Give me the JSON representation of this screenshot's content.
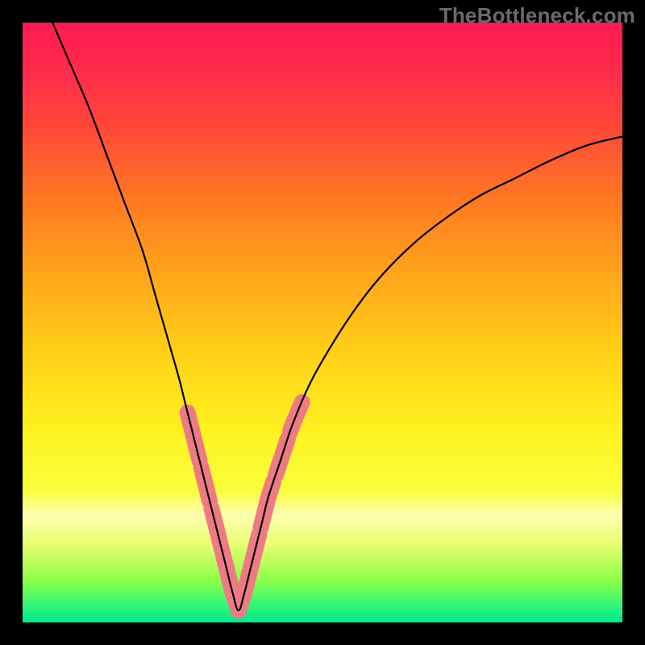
{
  "watermark": "TheBottleneck.com",
  "gradient_stops": [
    {
      "offset": 0.0,
      "color": "#ff1a52"
    },
    {
      "offset": 0.08,
      "color": "#ff2b4b"
    },
    {
      "offset": 0.18,
      "color": "#ff4a37"
    },
    {
      "offset": 0.3,
      "color": "#ff7a22"
    },
    {
      "offset": 0.42,
      "color": "#ffa51a"
    },
    {
      "offset": 0.55,
      "color": "#ffd017"
    },
    {
      "offset": 0.68,
      "color": "#fff220"
    },
    {
      "offset": 0.78,
      "color": "#f8ff3c"
    },
    {
      "offset": 0.82,
      "color": "#ffffb0"
    },
    {
      "offset": 0.87,
      "color": "#e8ff70"
    },
    {
      "offset": 0.93,
      "color": "#8cff4a"
    },
    {
      "offset": 0.975,
      "color": "#28f57a"
    },
    {
      "offset": 1.0,
      "color": "#00e88e"
    }
  ],
  "chart_data": {
    "type": "line",
    "title": "",
    "xlabel": "",
    "ylabel": "",
    "xlim": [
      0,
      100
    ],
    "ylim": [
      0,
      100
    ],
    "series": [
      {
        "name": "curve-left",
        "x": [
          5,
          8,
          11,
          14,
          17,
          20,
          22,
          24,
          26,
          27,
          28,
          29,
          30,
          31,
          32,
          33,
          34,
          35,
          36
        ],
        "y": [
          100,
          93,
          86,
          78,
          70,
          62,
          55,
          48,
          41,
          37,
          33,
          29,
          25,
          21,
          17,
          13,
          9,
          5,
          2
        ]
      },
      {
        "name": "curve-right",
        "x": [
          36,
          37,
          38,
          39,
          40,
          41,
          43,
          45,
          48,
          52,
          56,
          60,
          65,
          70,
          76,
          82,
          88,
          94,
          100
        ],
        "y": [
          2,
          5,
          9,
          13,
          17,
          21,
          27,
          33,
          40,
          47,
          53,
          58,
          63,
          67,
          71,
          74,
          77,
          79.5,
          81
        ]
      }
    ],
    "valley_x": 36,
    "pink_band": {
      "color": "#ee7b84",
      "segments": [
        {
          "branch": "left",
          "x_from": 27.5,
          "x_to": 29.5
        },
        {
          "branch": "left",
          "x_from": 29.8,
          "x_to": 31.2
        },
        {
          "branch": "left",
          "x_from": 31.5,
          "x_to": 33.2
        },
        {
          "branch": "left",
          "x_from": 33.4,
          "x_to": 35.2
        },
        {
          "branch": "left",
          "x_from": 35.2,
          "x_to": 36.0
        },
        {
          "branch": "right",
          "x_from": 36.0,
          "x_to": 37.4
        },
        {
          "branch": "right",
          "x_from": 37.6,
          "x_to": 39.4
        },
        {
          "branch": "right",
          "x_from": 39.7,
          "x_to": 41.8
        },
        {
          "branch": "right",
          "x_from": 42.2,
          "x_to": 44.2
        },
        {
          "branch": "right",
          "x_from": 44.6,
          "x_to": 46.6
        }
      ]
    }
  }
}
